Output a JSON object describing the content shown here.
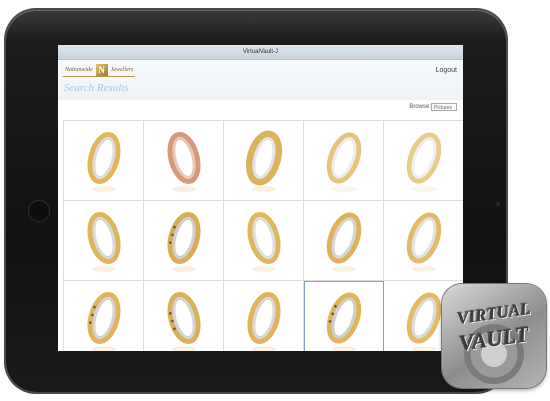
{
  "window": {
    "title": "VirtualVault-J"
  },
  "header": {
    "logo_text_left": "Nationwide",
    "logo_mark": "N",
    "logo_text_right": "Jewellers",
    "logout_label": "Logout",
    "page_title": "Search Results"
  },
  "browse": {
    "label": "Browse:",
    "selected": "Pictures"
  },
  "app_icon": {
    "line1": "VIRTUAL",
    "line2": "VAULT"
  },
  "rings": [
    {
      "style": "gold-silver",
      "gold": "#e2b75a",
      "silver": "#dcdcdc"
    },
    {
      "style": "rose",
      "gold": "#d59a7a",
      "silver": "#e8c9b8"
    },
    {
      "style": "wide-gold",
      "gold": "#dbb35c",
      "silver": "#e4e4e4"
    },
    {
      "style": "thin-gold",
      "gold": "#e7c47e",
      "silver": "#ededed"
    },
    {
      "style": "thin-gold",
      "gold": "#e9cc8c",
      "silver": "#f0f0f0"
    },
    {
      "style": "silver-gold",
      "gold": "#e0b45a",
      "silver": "#d8d8d8"
    },
    {
      "style": "diamond",
      "gold": "#d9ad56",
      "silver": "#cfcfcf"
    },
    {
      "style": "gold-silver",
      "gold": "#e2b75a",
      "silver": "#dedede"
    },
    {
      "style": "gold-silver",
      "gold": "#dfb15a",
      "silver": "#d6d6d6"
    },
    {
      "style": "thin-gold",
      "gold": "#e2bb6a",
      "silver": "#e2e2e2"
    },
    {
      "style": "diamond",
      "gold": "#e0b45a",
      "silver": "#d4d4d4"
    },
    {
      "style": "diamond",
      "gold": "#dcb05a",
      "silver": "#d4d4d4"
    },
    {
      "style": "gold-silver",
      "gold": "#e0b45a",
      "silver": "#d8d8d8"
    },
    {
      "style": "diamond",
      "gold": "#e0b45a",
      "silver": "#cfcfcf",
      "selected": true
    },
    {
      "style": "gold-silver",
      "gold": "#e4bb64",
      "silver": "#dcdcdc"
    }
  ]
}
